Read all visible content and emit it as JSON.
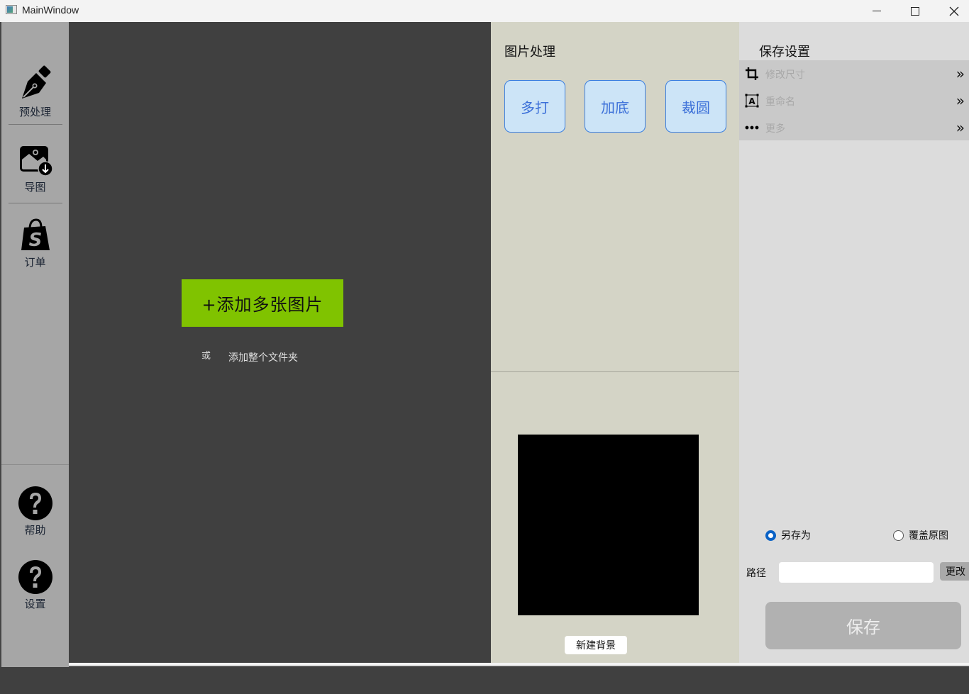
{
  "window": {
    "title": "MainWindow",
    "controls": {
      "minimize": "minimize-icon",
      "maximize": "maximize-icon",
      "close": "close-icon"
    }
  },
  "sidebar": {
    "top_items": [
      {
        "label": "预处理",
        "icon": "fountain-pen-icon"
      },
      {
        "label": "导图",
        "icon": "image-download-icon"
      },
      {
        "label": "订单",
        "icon": "shopping-bag-icon"
      }
    ],
    "bottom_items": [
      {
        "label": "帮助",
        "icon": "help-icon"
      },
      {
        "label": "设置",
        "icon": "help-icon"
      }
    ]
  },
  "main": {
    "add_images_label": "+添加多张图片",
    "or_text": "或",
    "add_folder_label": "添加整个文件夹"
  },
  "processing": {
    "title": "图片处理",
    "buttons": [
      {
        "label": "多打"
      },
      {
        "label": "加底"
      },
      {
        "label": "裁圆"
      }
    ],
    "new_background_label": "新建背景",
    "preview_color": "#000000"
  },
  "save_settings": {
    "title": "保存设置",
    "options": [
      {
        "label": "修改尺寸",
        "icon": "crop-icon",
        "chevron": "»"
      },
      {
        "label": "重命名",
        "icon": "rename-icon",
        "chevron": "»"
      },
      {
        "label": "更多",
        "icon": "more-dots-icon",
        "chevron": "»"
      }
    ],
    "radio_save_as": {
      "label": "另存为",
      "checked": true
    },
    "radio_overwrite": {
      "label": "覆盖原图",
      "checked": false
    },
    "path_label": "路径",
    "path_value": "",
    "path_placeholder": "",
    "change_label": "更改",
    "save_label": "保存"
  },
  "colors": {
    "accent_green": "#80c300",
    "button_blue": "#3b7fe0",
    "radio_blue": "#0a62c6"
  }
}
